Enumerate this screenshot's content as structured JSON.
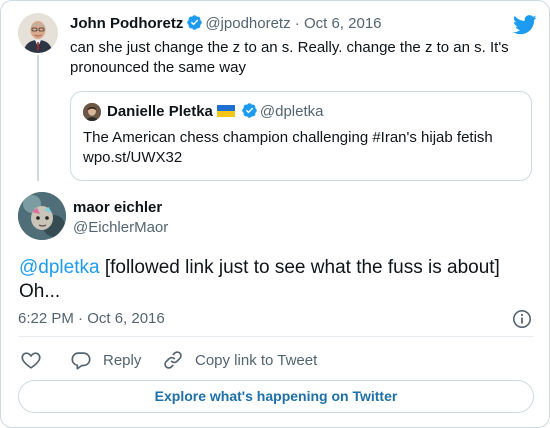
{
  "parent_tweet": {
    "author_name": "John Podhoretz",
    "author_handle": "@jpodhoretz",
    "separator": "·",
    "date": "Oct 6, 2016",
    "text": "can she just change the z to an s. Really. change the z to an s. It's pronounced the same way",
    "verified": true
  },
  "quoted_tweet": {
    "author_name": "Danielle Pletka",
    "author_flag": "ukraine-flag",
    "author_handle": "@dpletka",
    "verified": true,
    "text_line1": "The American chess champion challenging #Iran's hijab fetish",
    "text_line2": "wpo.st/UWX32"
  },
  "main_tweet": {
    "author_name": "maor eichler",
    "author_handle": "@EichlerMaor",
    "mention": "@dpletka",
    "text_rest": " [followed link just to see what the fuss is about] Oh...",
    "timestamp": "6:22 PM · Oct 6, 2016"
  },
  "actions": {
    "like_icon": "heart-icon",
    "reply_label": "Reply",
    "copy_label": "Copy link to Tweet"
  },
  "explore_label": "Explore what's happening on Twitter",
  "colors": {
    "brand_blue": "#1d9bf0",
    "text_primary": "#0f1419",
    "text_secondary": "#536471",
    "border": "#cfd9de",
    "explore_text": "#1d6fa7"
  }
}
